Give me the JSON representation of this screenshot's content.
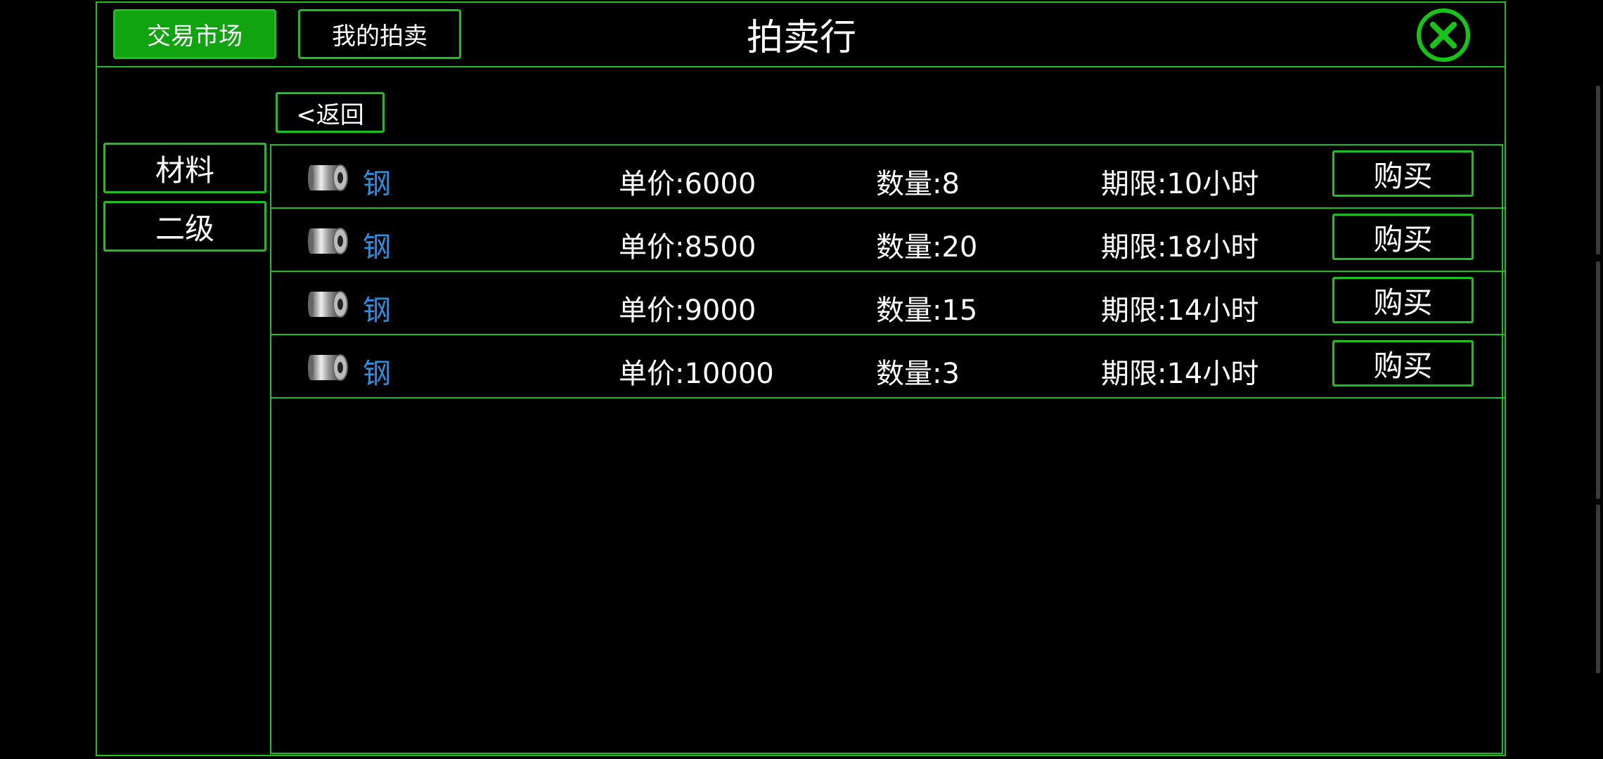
{
  "header": {
    "tabs": [
      {
        "label": "交易市场",
        "active": true
      },
      {
        "label": "我的拍卖",
        "active": false
      }
    ],
    "title": "拍卖行",
    "close_icon": "close-x-circle-icon"
  },
  "navigation": {
    "back_label": "<返回"
  },
  "categories": [
    {
      "label": "材料"
    },
    {
      "label": "二级"
    }
  ],
  "listings": [
    {
      "icon": "steel-coil-icon",
      "name": "钢",
      "price": "单价:6000",
      "quantity": "数量:8",
      "period": "期限:10小时",
      "buy_label": "购买"
    },
    {
      "icon": "steel-coil-icon",
      "name": "钢",
      "price": "单价:8500",
      "quantity": "数量:20",
      "period": "期限:18小时",
      "buy_label": "购买"
    },
    {
      "icon": "steel-coil-icon",
      "name": "钢",
      "price": "单价:9000",
      "quantity": "数量:15",
      "period": "期限:14小时",
      "buy_label": "购买"
    },
    {
      "icon": "steel-coil-icon",
      "name": "钢",
      "price": "单价:10000",
      "quantity": "数量:3",
      "period": "期限:14小时",
      "buy_label": "购买"
    }
  ],
  "colors": {
    "accent_green": "#1fbf1f",
    "active_tab": "#10a510",
    "item_name_blue": "#2b8fe0",
    "background": "#000000"
  }
}
